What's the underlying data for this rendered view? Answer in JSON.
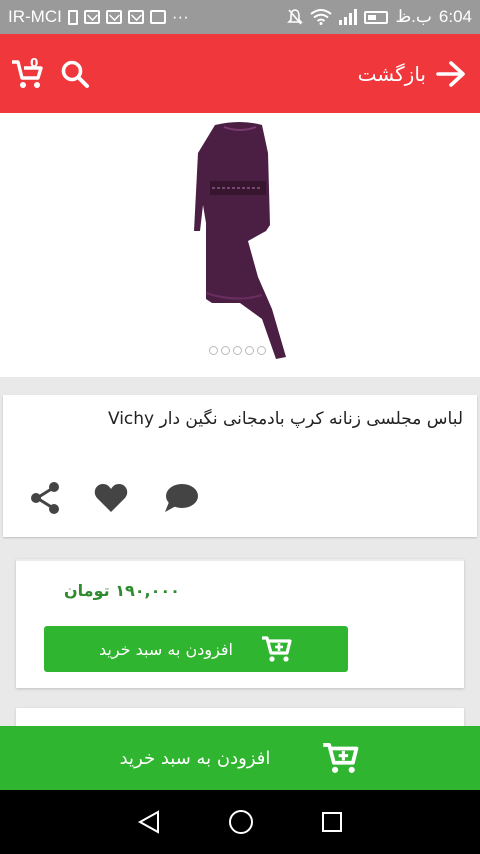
{
  "status_bar": {
    "carrier": "IR-MCI",
    "time": "6:04",
    "ampm": "ب.ظ",
    "more": "···"
  },
  "app_bar": {
    "back_label": "بازگشت",
    "cart_count": "0",
    "color": "#f0373b"
  },
  "gallery": {
    "dot_count": 5
  },
  "product": {
    "title": "لباس مجلسی زنانه کرپ بادمجانی نگین دار Vichy"
  },
  "price_card": {
    "price": "۱۹۰,۰۰۰ تومان",
    "add_label": "افزودن به سبد خرید"
  },
  "bottom_bar": {
    "add_label": "افزودن به سبد خرید",
    "color": "#2fb52f"
  },
  "icons": {
    "share": "share-icon",
    "like": "heart-icon",
    "comment": "comment-icon",
    "search": "search-icon",
    "cart": "cart-icon",
    "back": "arrow-right-icon"
  }
}
